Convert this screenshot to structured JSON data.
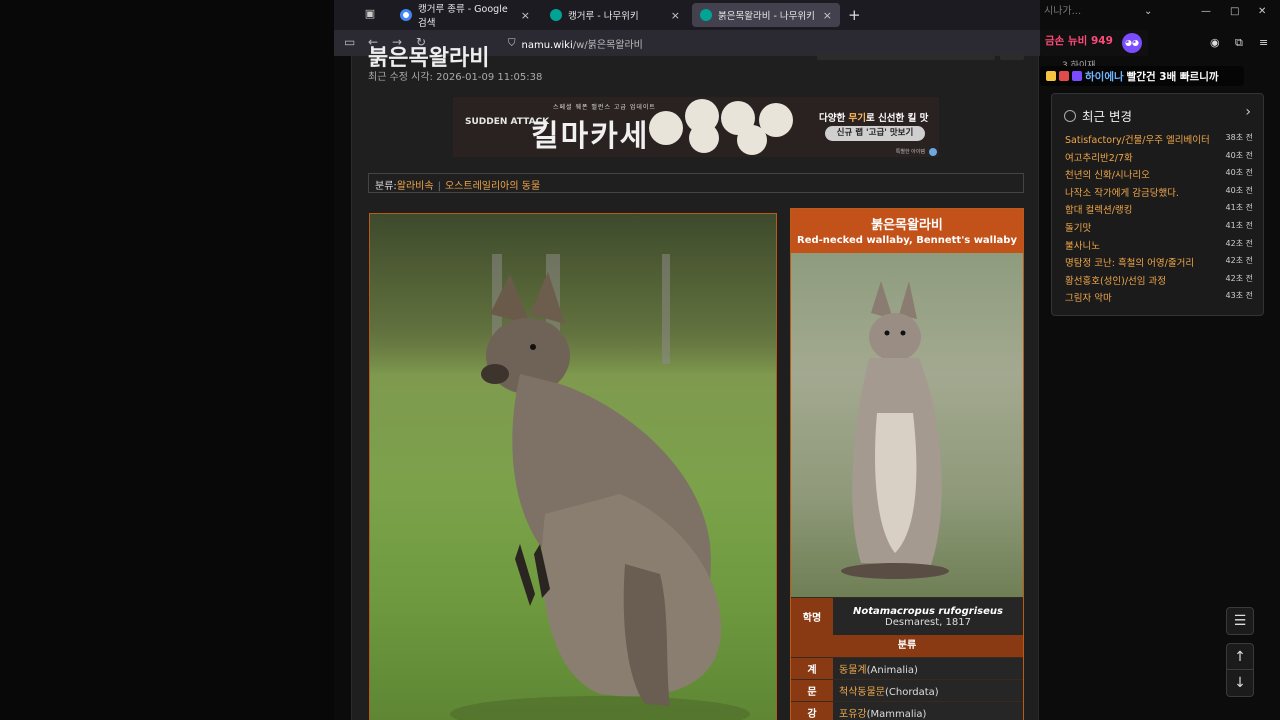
{
  "browser": {
    "tabs": [
      {
        "label": "캥거루 종류 - Google 검색",
        "active": false,
        "favicon": "google-favicon"
      },
      {
        "label": "캥거루 - 나무위키",
        "active": false,
        "favicon": "namu-favicon"
      },
      {
        "label": "붉은목왈라비 - 나무위키",
        "active": true,
        "favicon": "namu-favicon"
      }
    ],
    "close_glyph": "×",
    "new_tab_glyph": "+",
    "url_host": "namu.wiki",
    "url_path": "/w/붉은목왈라비",
    "back_glyph": "←",
    "forward_glyph": "→",
    "reload_glyph": "↻"
  },
  "article": {
    "title_cut": "붉은목왈라비",
    "updated": "최근 수정 시각: 2026-01-09 11:05:38",
    "banner": {
      "top_small": "스페셜 웨폰 밸런스 고급 업데이트",
      "brand": "SUDDEN ATTACK",
      "title": "킬마카세",
      "right_text_pre": "다양한 ",
      "right_text_em": "무기",
      "right_text_post": "로 신선한 킬 맛",
      "cta": "신규 랩 '고급' 맛보기",
      "badge": "특별한 아이템"
    },
    "categories": {
      "prefix": "분류:",
      "items": [
        "왈라비속",
        "오스트레일리아의 동물"
      ],
      "separator": "|"
    },
    "infobox": {
      "name_ko": "붉은목왈라비",
      "name_en": "Red-necked wallaby, Bennett's wallaby",
      "sci_label": "학명",
      "sci_name": "Notamacropus rufogriseus",
      "sci_author": "Desmarest, 1817",
      "section": "분류",
      "rows": [
        {
          "k": "계",
          "link": "동물계",
          "rest": "(Animalia)"
        },
        {
          "k": "문",
          "link": "척삭동물문",
          "rest": "(Chordata)"
        },
        {
          "k": "강",
          "link": "포유강",
          "rest": "(Mammalia)"
        }
      ]
    }
  },
  "recent_changes": {
    "title": "최근 변경",
    "arrow": "›",
    "items": [
      {
        "t": "Satisfactory/건물/우주 엘리베이터",
        "ago": "38초 전"
      },
      {
        "t": "여고추리반2/7화",
        "ago": "40초 전"
      },
      {
        "t": "천년의 신화/시나리오",
        "ago": "40초 전"
      },
      {
        "t": "나작소 작가에게 감금당했다.",
        "ago": "40초 전"
      },
      {
        "t": "함대 컬렉션/랭킹",
        "ago": "41초 전"
      },
      {
        "t": "돌기맛",
        "ago": "41초 전"
      },
      {
        "t": "불사니노",
        "ago": "42초 전"
      },
      {
        "t": "명탐정 코난: 흑철의 어영/줄거리",
        "ago": "42초 전"
      },
      {
        "t": "황선홍호(성인)/선임 과정",
        "ago": "42초 전"
      },
      {
        "t": "그림자 악마",
        "ago": "43초 전"
      }
    ]
  },
  "overlay": {
    "stream_top": "시나가...",
    "donation": "금손 뉴비 949",
    "rank_line": "3  하이재",
    "chat_name": "하이에나",
    "chat_body": "빨간건 3배 빠르니까"
  },
  "controls": {
    "toc_glyph": "☰",
    "up_glyph": "↑",
    "down_glyph": "↓"
  },
  "colors": {
    "accent": "#c3521a",
    "link": "#f0a64a",
    "page_bg": "#1f1f1f"
  }
}
